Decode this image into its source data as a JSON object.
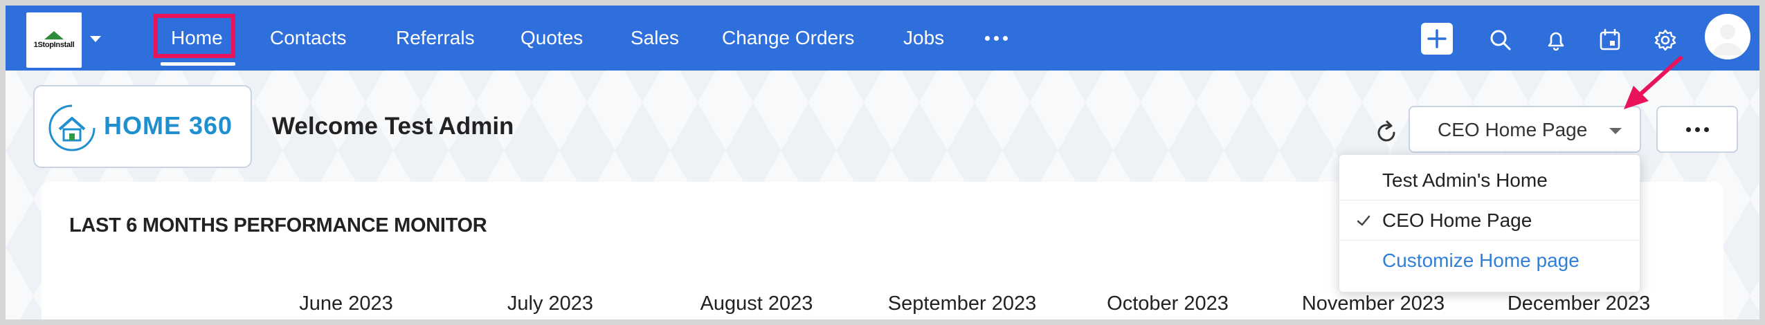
{
  "app": {
    "logo_text": "1StopInstall"
  },
  "nav": {
    "items": [
      {
        "label": "Home"
      },
      {
        "label": "Contacts"
      },
      {
        "label": "Referrals"
      },
      {
        "label": "Quotes"
      },
      {
        "label": "Sales"
      },
      {
        "label": "Change Orders"
      },
      {
        "label": "Jobs"
      }
    ],
    "active": "Home"
  },
  "toolbar_icons": [
    "plus-icon",
    "search-icon",
    "bell-icon",
    "calendar-icon",
    "gear-icon",
    "avatar"
  ],
  "header": {
    "brand": "HOME 360",
    "welcome": "Welcome Test Admin",
    "selected_page": "CEO Home Page"
  },
  "dropdown": {
    "items": [
      {
        "label": "Test Admin's Home",
        "checked": false
      },
      {
        "label": "CEO Home Page",
        "checked": true
      },
      {
        "label": "Customize Home page",
        "link": true
      }
    ]
  },
  "card": {
    "title": "LAST 6 MONTHS PERFORMANCE MONITOR",
    "months": [
      "June 2023",
      "July 2023",
      "August 2023",
      "September 2023",
      "October 2023",
      "November 2023",
      "December 2023"
    ]
  },
  "colors": {
    "nav_bg": "#2f6fdc",
    "highlight": "#e8135a",
    "link": "#2f7fd6"
  }
}
